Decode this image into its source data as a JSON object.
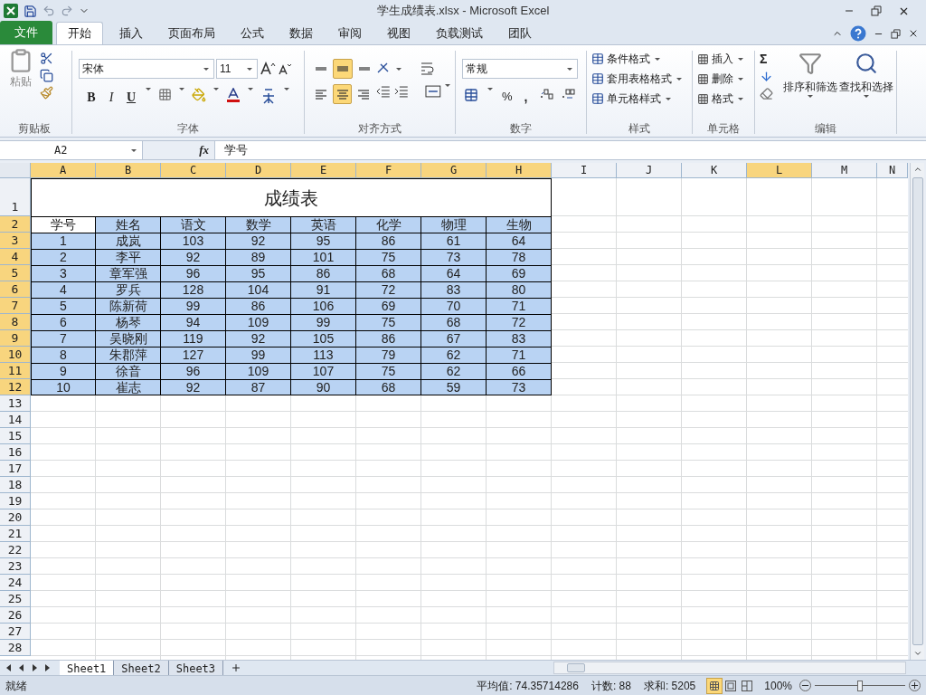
{
  "window": {
    "title": "学生成绩表.xlsx - Microsoft Excel"
  },
  "ribbon_tabs": [
    {
      "label": "文件",
      "kind": "file",
      "selected": false
    },
    {
      "label": "开始",
      "kind": "tab",
      "selected": true
    },
    {
      "label": "插入",
      "kind": "tab",
      "selected": false
    },
    {
      "label": "页面布局",
      "kind": "tab",
      "selected": false
    },
    {
      "label": "公式",
      "kind": "tab",
      "selected": false
    },
    {
      "label": "数据",
      "kind": "tab",
      "selected": false
    },
    {
      "label": "审阅",
      "kind": "tab",
      "selected": false
    },
    {
      "label": "视图",
      "kind": "tab",
      "selected": false
    },
    {
      "label": "负载测试",
      "kind": "tab",
      "selected": false
    },
    {
      "label": "团队",
      "kind": "tab",
      "selected": false
    }
  ],
  "clipboard": {
    "paste": "粘贴",
    "label": "剪贴板"
  },
  "font": {
    "name": "宋体",
    "size": "11",
    "bold": "B",
    "italic": "I",
    "underline": "U",
    "label": "字体"
  },
  "alignment": {
    "vertical": [
      {
        "kind": "top",
        "selected": false
      },
      {
        "kind": "middle",
        "selected": true
      },
      {
        "kind": "bottom",
        "selected": false
      }
    ],
    "horizontal": [
      {
        "kind": "left",
        "selected": false
      },
      {
        "kind": "center",
        "selected": true
      },
      {
        "kind": "right",
        "selected": false
      }
    ],
    "label": "对齐方式"
  },
  "number": {
    "format": "常规",
    "percent": "%",
    "comma": ",",
    "label": "数字"
  },
  "styles": {
    "items": [
      "条件格式",
      "套用表格格式",
      "单元格样式"
    ],
    "label": "样式"
  },
  "cells": {
    "items": [
      "插入",
      "删除",
      "格式"
    ],
    "label": "单元格"
  },
  "editing": {
    "sum": "Σ",
    "buttons": [
      "排序和筛选",
      "查找和选择"
    ],
    "label": "编辑"
  },
  "formula_bar": {
    "name_box": "A2",
    "fx": "fx",
    "value": "学号"
  },
  "columns": [
    {
      "label": "A",
      "selected": true
    },
    {
      "label": "B",
      "selected": true
    },
    {
      "label": "C",
      "selected": true
    },
    {
      "label": "D",
      "selected": true
    },
    {
      "label": "E",
      "selected": true
    },
    {
      "label": "F",
      "selected": true
    },
    {
      "label": "G",
      "selected": true
    },
    {
      "label": "H",
      "selected": true
    },
    {
      "label": "I",
      "selected": false
    },
    {
      "label": "J",
      "selected": false
    },
    {
      "label": "K",
      "selected": false
    },
    {
      "label": "L",
      "selected": true
    },
    {
      "label": "M",
      "selected": false
    },
    {
      "label": "N",
      "selected": false
    }
  ],
  "row_headers": [
    {
      "label": "1",
      "selected": false
    },
    {
      "label": "2",
      "selected": true
    },
    {
      "label": "3",
      "selected": true
    },
    {
      "label": "4",
      "selected": true
    },
    {
      "label": "5",
      "selected": true
    },
    {
      "label": "6",
      "selected": true
    },
    {
      "label": "7",
      "selected": true
    },
    {
      "label": "8",
      "selected": true
    },
    {
      "label": "9",
      "selected": true
    },
    {
      "label": "10",
      "selected": true
    },
    {
      "label": "11",
      "selected": true
    },
    {
      "label": "12",
      "selected": true
    },
    {
      "label": "13",
      "selected": false
    },
    {
      "label": "14",
      "selected": false
    },
    {
      "label": "15",
      "selected": false
    },
    {
      "label": "16",
      "selected": false
    },
    {
      "label": "17",
      "selected": false
    },
    {
      "label": "18",
      "selected": false
    },
    {
      "label": "19",
      "selected": false
    },
    {
      "label": "20",
      "selected": false
    },
    {
      "label": "21",
      "selected": false
    },
    {
      "label": "22",
      "selected": false
    },
    {
      "label": "23",
      "selected": false
    },
    {
      "label": "24",
      "selected": false
    },
    {
      "label": "25",
      "selected": false
    },
    {
      "label": "26",
      "selected": false
    },
    {
      "label": "27",
      "selected": false
    },
    {
      "label": "28",
      "selected": false
    }
  ],
  "table": {
    "title": "成绩表",
    "header": {
      "selected": true,
      "cells": [
        {
          "text": "学号",
          "active": true
        },
        {
          "text": "姓名",
          "active": false
        },
        {
          "text": "语文",
          "active": false
        },
        {
          "text": "数学",
          "active": false
        },
        {
          "text": "英语",
          "active": false
        },
        {
          "text": "化学",
          "active": false
        },
        {
          "text": "物理",
          "active": false
        },
        {
          "text": "生物",
          "active": false
        }
      ]
    },
    "rows": [
      {
        "selected": true,
        "cells": [
          "1",
          "成岚",
          "103",
          "92",
          "95",
          "86",
          "61",
          "64"
        ]
      },
      {
        "selected": true,
        "cells": [
          "2",
          "李平",
          "92",
          "89",
          "101",
          "75",
          "73",
          "78"
        ]
      },
      {
        "selected": true,
        "cells": [
          "3",
          "章军强",
          "96",
          "95",
          "86",
          "68",
          "64",
          "69"
        ]
      },
      {
        "selected": true,
        "cells": [
          "4",
          "罗兵",
          "128",
          "104",
          "91",
          "72",
          "83",
          "80"
        ]
      },
      {
        "selected": true,
        "cells": [
          "5",
          "陈新荷",
          "99",
          "86",
          "106",
          "69",
          "70",
          "71"
        ]
      },
      {
        "selected": true,
        "cells": [
          "6",
          "杨琴",
          "94",
          "109",
          "99",
          "75",
          "68",
          "72"
        ]
      },
      {
        "selected": true,
        "cells": [
          "7",
          "吴晓刚",
          "119",
          "92",
          "105",
          "86",
          "67",
          "83"
        ]
      },
      {
        "selected": true,
        "cells": [
          "8",
          "朱郡萍",
          "127",
          "99",
          "113",
          "79",
          "62",
          "71"
        ]
      },
      {
        "selected": true,
        "cells": [
          "9",
          "徐音",
          "96",
          "109",
          "107",
          "75",
          "62",
          "66"
        ]
      },
      {
        "selected": true,
        "cells": [
          "10",
          "崔志",
          "92",
          "87",
          "90",
          "68",
          "59",
          "73"
        ]
      }
    ]
  },
  "sheet_tabs": [
    {
      "label": "Sheet1",
      "selected": true
    },
    {
      "label": "Sheet2",
      "selected": false
    },
    {
      "label": "Sheet3",
      "selected": false
    }
  ],
  "status_bar": {
    "mode": "就绪",
    "average": "平均值: 74.35714286",
    "count": "计数: 88",
    "sum": "求和: 5205",
    "views": [
      {
        "kind": "normal",
        "selected": true
      },
      {
        "kind": "page_layout",
        "selected": false
      },
      {
        "kind": "page_break",
        "selected": false
      }
    ],
    "zoom": "100%",
    "zoom_level": {
      "level": 0.5
    }
  }
}
